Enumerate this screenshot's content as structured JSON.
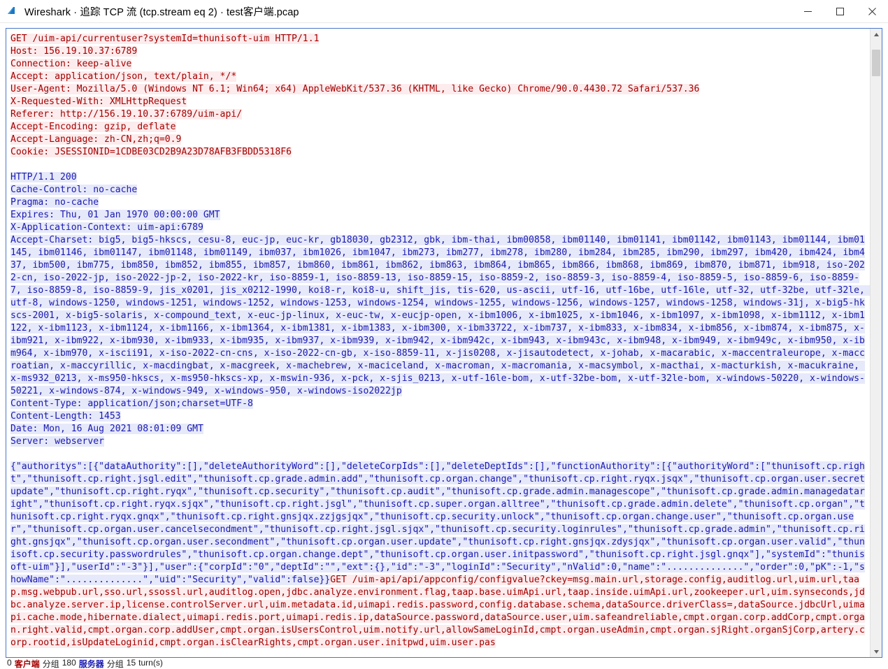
{
  "window": {
    "title": "Wireshark · 追踪 TCP 流 (tcp.stream eq 2) · test客户端.pcap",
    "icon": "wireshark-fin-icon",
    "minimize_label": "–",
    "maximize_label": "□",
    "close_label": "×"
  },
  "scrollbar": {
    "up_label": "▲",
    "down_label": "▼"
  },
  "statusbar": {
    "client_packets": "0",
    "client_label": "客户端",
    "client_unit": "分组",
    "server_packets": "180",
    "server_label": "服务器",
    "server_unit": "分组",
    "turns_count": "15",
    "turns_label": "turn(s)"
  },
  "stream": {
    "request_1": "GET /uim-api/currentuser?systemId=thunisoft-uim HTTP/1.1\nHost: 156.19.10.37:6789\nConnection: keep-alive\nAccept: application/json, text/plain, */*\nUser-Agent: Mozilla/5.0 (Windows NT 6.1; Win64; x64) AppleWebKit/537.36 (KHTML, like Gecko) Chrome/90.0.4430.72 Safari/537.36\nX-Requested-With: XMLHttpRequest\nReferer: http://156.19.10.37:6789/uim-api/\nAccept-Encoding: gzip, deflate\nAccept-Language: zh-CN,zh;q=0.9\nCookie: JSESSIONID=1CDBE03CD2B9A23D78AFB3FBDD5318F6\n",
    "response_1": "HTTP/1.1 200\nCache-Control: no-cache\nPragma: no-cache\nExpires: Thu, 01 Jan 1970 00:00:00 GMT\nX-Application-Context: uim-api:6789\nAccept-Charset: big5, big5-hkscs, cesu-8, euc-jp, euc-kr, gb18030, gb2312, gbk, ibm-thai, ibm00858, ibm01140, ibm01141, ibm01142, ibm01143, ibm01144, ibm01145, ibm01146, ibm01147, ibm01148, ibm01149, ibm037, ibm1026, ibm1047, ibm273, ibm277, ibm278, ibm280, ibm284, ibm285, ibm290, ibm297, ibm420, ibm424, ibm437, ibm500, ibm775, ibm850, ibm852, ibm855, ibm857, ibm860, ibm861, ibm862, ibm863, ibm864, ibm865, ibm866, ibm868, ibm869, ibm870, ibm871, ibm918, iso-2022-cn, iso-2022-jp, iso-2022-jp-2, iso-2022-kr, iso-8859-1, iso-8859-13, iso-8859-15, iso-8859-2, iso-8859-3, iso-8859-4, iso-8859-5, iso-8859-6, iso-8859-7, iso-8859-8, iso-8859-9, jis_x0201, jis_x0212-1990, koi8-r, koi8-u, shift_jis, tis-620, us-ascii, utf-16, utf-16be, utf-16le, utf-32, utf-32be, utf-32le, utf-8, windows-1250, windows-1251, windows-1252, windows-1253, windows-1254, windows-1255, windows-1256, windows-1257, windows-1258, windows-31j, x-big5-hkscs-2001, x-big5-solaris, x-compound_text, x-euc-jp-linux, x-euc-tw, x-eucjp-open, x-ibm1006, x-ibm1025, x-ibm1046, x-ibm1097, x-ibm1098, x-ibm1112, x-ibm1122, x-ibm1123, x-ibm1124, x-ibm1166, x-ibm1364, x-ibm1381, x-ibm1383, x-ibm300, x-ibm33722, x-ibm737, x-ibm833, x-ibm834, x-ibm856, x-ibm874, x-ibm875, x-ibm921, x-ibm922, x-ibm930, x-ibm933, x-ibm935, x-ibm937, x-ibm939, x-ibm942, x-ibm942c, x-ibm943, x-ibm943c, x-ibm948, x-ibm949, x-ibm949c, x-ibm950, x-ibm964, x-ibm970, x-iscii91, x-iso-2022-cn-cns, x-iso-2022-cn-gb, x-iso-8859-11, x-jis0208, x-jisautodetect, x-johab, x-macarabic, x-maccentraleurope, x-maccroatian, x-maccyrillic, x-macdingbat, x-macgreek, x-machebrew, x-maciceland, x-macroman, x-macromania, x-macsymbol, x-macthai, x-macturkish, x-macukraine, x-ms932_0213, x-ms950-hkscs, x-ms950-hkscs-xp, x-mswin-936, x-pck, x-sjis_0213, x-utf-16le-bom, x-utf-32be-bom, x-utf-32le-bom, x-windows-50220, x-windows-50221, x-windows-874, x-windows-949, x-windows-950, x-windows-iso2022jp\nContent-Type: application/json;charset=UTF-8\nContent-Length: 1453\nDate: Mon, 16 Aug 2021 08:01:09 GMT\nServer: webserver\n",
    "response_body": "{\"authoritys\":[{\"dataAuthority\":[],\"deleteAuthorityWord\":[],\"deleteCorpIds\":[],\"deleteDeptIds\":[],\"functionAuthority\":[{\"authorityWord\":[\"thunisoft.cp.right\",\"thunisoft.cp.right.jsgl.edit\",\"thunisoft.cp.grade.admin.add\",\"thunisoft.cp.organ.change\",\"thunisoft.cp.right.ryqx.jsqx\",\"thunisoft.cp.organ.user.secretupdate\",\"thunisoft.cp.right.ryqx\",\"thunisoft.cp.security\",\"thunisoft.cp.audit\",\"thunisoft.cp.grade.admin.managescope\",\"thunisoft.cp.grade.admin.managedataright\",\"thunisoft.cp.right.ryqx.sjqx\",\"thunisoft.cp.right.jsgl\",\"thunisoft.cp.super.organ.alltree\",\"thunisoft.cp.grade.admin.delete\",\"thunisoft.cp.organ\",\"thunisoft.cp.right.ryqx.gnqx\",\"thunisoft.cp.right.gnsjqx.zzjgsjqx\",\"thunisoft.cp.security.unlock\",\"thunisoft.cp.organ.change.user\",\"thunisoft.cp.organ.user\",\"thunisoft.cp.organ.user.cancelsecondment\",\"thunisoft.cp.right.jsgl.sjqx\",\"thunisoft.cp.security.loginrules\",\"thunisoft.cp.grade.admin\",\"thunisoft.cp.right.gnsjqx\",\"thunisoft.cp.organ.user.secondment\",\"thunisoft.cp.organ.user.update\",\"thunisoft.cp.right.gnsjqx.zdysjqx\",\"thunisoft.cp.organ.user.valid\",\"thunisoft.cp.security.passwordrules\",\"thunisoft.cp.organ.change.dept\",\"thunisoft.cp.organ.user.initpassword\",\"thunisoft.cp.right.jsgl.gnqx\"],\"systemId\":\"thunisoft-uim\"}],\"userId\":\"-3\"}],\"user\":{\"corpId\":\"0\",\"deptId\":\"\",\"ext\":{},\"id\":\"-3\",\"loginId\":\"Security\",\"nValid\":0,\"name\":\"..............\",\"order\":0,\"pK\":-1,\"showName\":\"..............\",\"uid\":\"Security\",\"valid\":false}}",
    "request_2": "GET /uim-api/api/appconfig/configvalue?ckey=msg.main.url,storage.config,auditlog.url,uim.url,taap.msg.webpub.url,sso.url,ssossl.url,auditlog.open,jdbc.analyze.environment.flag,taap.base.uimApi.url,taap.inside.uimApi.url,zookeeper.url,uim.synseconds,jdbc.analyze.server.ip,license.controlServer.url,uim.metadata.id,uimapi.redis.password,config.database.schema,dataSource.driverClass=,dataSource.jdbcUrl,uimapi.cache.mode,hibernate.dialect,uimapi.redis.port,uimapi.redis.ip,dataSource.password,dataSource.user,uim.safeandreliable,cmpt.organ.corp.addCorp,cmpt.organ.right.valid,cmpt.organ.corp.addUser,cmpt.organ.isUsersControl,uim.notify.url,allowSameLoginId,cmpt.organ.useAdmin,cmpt.organ.sjRight.organSjCorp,artery.corp.rootid,isUpdateLoginid,cmpt.organ.isClearRights,cmpt.organ.user.initpwd,uim.user.pas"
  }
}
